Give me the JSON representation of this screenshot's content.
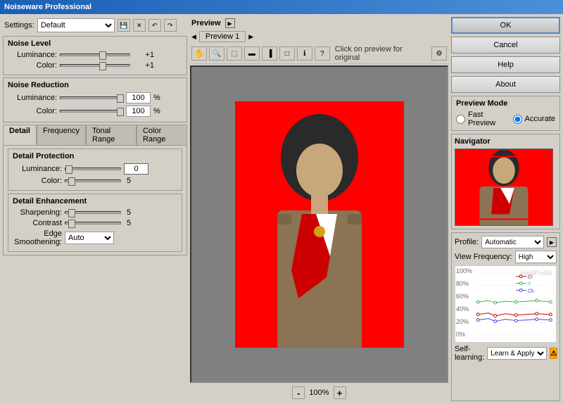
{
  "titleBar": {
    "title": "Noiseware Professional"
  },
  "leftPanel": {
    "settingsLabel": "Settings:",
    "settingsValue": "Default",
    "noiseLevel": {
      "title": "Noise Level",
      "luminanceLabel": "Luminance:",
      "luminanceValue": "+1",
      "colorLabel": "Color:",
      "colorValue": "+1"
    },
    "noiseReduction": {
      "title": "Noise Reduction",
      "luminanceLabel": "Luminance:",
      "luminanceValue": "100",
      "luminancePercent": "%",
      "colorLabel": "Color:",
      "colorValue": "100",
      "colorPercent": "%"
    },
    "tabs": [
      "Detail",
      "Frequency",
      "Tonal Range",
      "Color Range"
    ],
    "activeTab": "Detail",
    "detailProtection": {
      "title": "Detail Protection",
      "luminanceLabel": "Luminance:",
      "luminanceValue": "0",
      "colorLabel": "Color:",
      "colorValue": "5"
    },
    "detailEnhancement": {
      "title": "Detail Enhancement",
      "sharpeningLabel": "Sharpening:",
      "sharpeningValue": "5",
      "contrastLabel": "Contrast",
      "contrastValue": "5",
      "edgeSmLabel": "Edge Smoothening:",
      "edgeSmValue": "Auto"
    }
  },
  "middlePanel": {
    "previewTitle": "Preview",
    "previewTabLabel": "Preview 1",
    "clickText": "Click on preview for original",
    "zoomValue": "100%",
    "zoomMinus": "-",
    "zoomPlus": "+"
  },
  "rightPanel": {
    "okLabel": "OK",
    "cancelLabel": "Cancel",
    "helpLabel": "Help",
    "aboutLabel": "About",
    "previewMode": {
      "title": "Preview Mode",
      "fastLabel": "Fast Preview",
      "accurateLabel": "Accurate"
    },
    "navigator": {
      "title": "Navigator"
    },
    "profile": {
      "title": "Profile:",
      "value": "Automatic",
      "viewFreqLabel": "View Frequency:",
      "viewFreqValue": "High",
      "intelliProfile": "IntelliProfile",
      "chartLabels": [
        "100%",
        "80%",
        "60%",
        "40%",
        "20%",
        "0%"
      ],
      "chartLegend": [
        {
          "label": "Cr",
          "color": "#cc0000"
        },
        {
          "label": "Y",
          "color": "#44aa44"
        },
        {
          "label": "Cb",
          "color": "#4444cc"
        }
      ]
    },
    "selfLearning": {
      "label": "Self-learning:",
      "value": "Learn & Apply"
    }
  }
}
